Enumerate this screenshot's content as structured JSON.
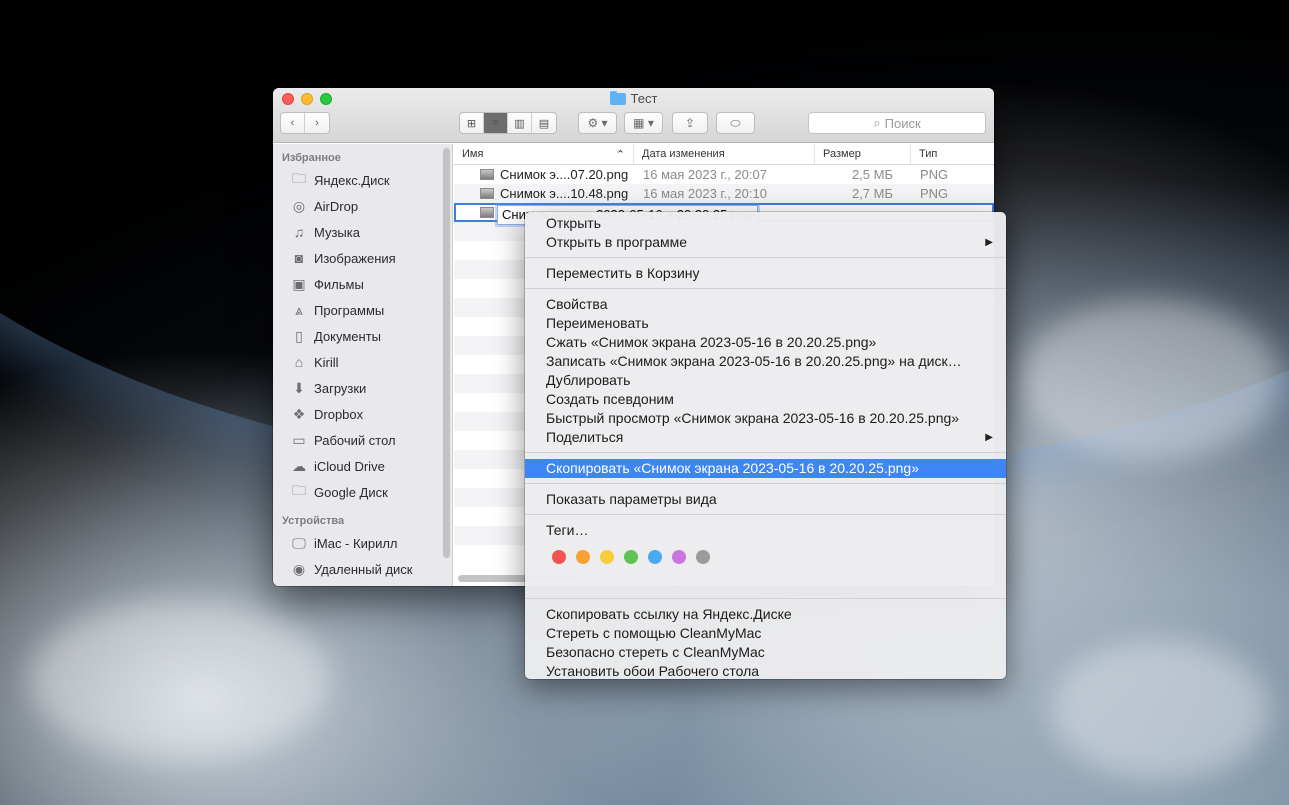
{
  "window": {
    "title": "Тест",
    "search_placeholder": "Поиск"
  },
  "sidebar": {
    "favorites_header": "Избранное",
    "favorites": [
      {
        "label": "Яндекс.Диск",
        "icon": "folder-icon"
      },
      {
        "label": "AirDrop",
        "icon": "airdrop-icon"
      },
      {
        "label": "Музыка",
        "icon": "music-icon"
      },
      {
        "label": "Изображения",
        "icon": "camera-icon"
      },
      {
        "label": "Фильмы",
        "icon": "film-icon"
      },
      {
        "label": "Программы",
        "icon": "apps-icon"
      },
      {
        "label": "Документы",
        "icon": "document-icon"
      },
      {
        "label": "Kirill",
        "icon": "home-icon"
      },
      {
        "label": "Загрузки",
        "icon": "download-icon"
      },
      {
        "label": "Dropbox",
        "icon": "dropbox-icon"
      },
      {
        "label": "Рабочий стол",
        "icon": "desktop-icon"
      },
      {
        "label": "iCloud Drive",
        "icon": "cloud-icon"
      },
      {
        "label": "Google Диск",
        "icon": "folder-icon"
      }
    ],
    "devices_header": "Устройства",
    "devices": [
      {
        "label": "iMac - Кирилл",
        "icon": "imac-icon"
      },
      {
        "label": "Удаленный диск",
        "icon": "disc-icon"
      }
    ]
  },
  "columns": {
    "name": "Имя",
    "date": "Дата изменения",
    "size": "Размер",
    "kind": "Тип"
  },
  "files": [
    {
      "name": "Снимок э....07.20.png",
      "date": "16 мая 2023 г., 20:07",
      "size": "2,5 МБ",
      "kind": "PNG"
    },
    {
      "name": "Снимок э....10.48.png",
      "date": "16 мая 2023 г., 20:10",
      "size": "2,7 МБ",
      "kind": "PNG"
    }
  ],
  "rename_value": "Снимок экрана 2023-05-16 в 20.20.25.png",
  "menu": {
    "group1": [
      "Открыть",
      "Открыть в программе"
    ],
    "group2": [
      "Переместить в Корзину"
    ],
    "group3": [
      "Свойства",
      "Переименовать",
      "Сжать «Снимок экрана 2023-05-16 в 20.20.25.png»",
      "Записать «Снимок экрана 2023-05-16 в 20.20.25.png» на диск…",
      "Дублировать",
      "Создать псевдоним",
      "Быстрый просмотр «Снимок экрана 2023-05-16 в 20.20.25.png»",
      "Поделиться"
    ],
    "copy_highlighted": "Скопировать «Снимок экрана 2023-05-16 в 20.20.25.png»",
    "view_options": "Показать параметры вида",
    "tags_label": "Теги…",
    "tag_colors": [
      "#f2554f",
      "#f7a133",
      "#f7ce3a",
      "#5fc354",
      "#4aaaf0",
      "#c777de",
      "#9b9b9b"
    ],
    "group_extra": [
      "Скопировать ссылку на Яндекс.Диске",
      "Стереть с помощью CleanMyMac",
      "Безопасно стереть с CleanMyMac",
      "Установить обои Рабочего стола"
    ]
  }
}
